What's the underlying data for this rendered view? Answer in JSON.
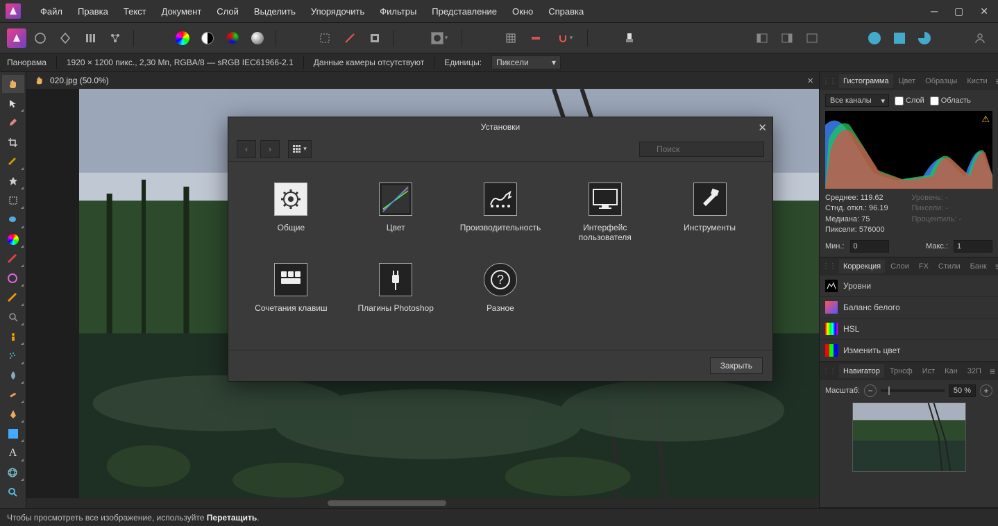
{
  "menu": [
    "Файл",
    "Правка",
    "Текст",
    "Документ",
    "Слой",
    "Выделить",
    "Упорядочить",
    "Фильтры",
    "Представление",
    "Окно",
    "Справка"
  ],
  "context": {
    "persona": "Панорама",
    "info": "1920 × 1200 пикс., 2,30 Мп, RGBA/8 — sRGB IEC61966-2.1",
    "camera": "Данные камеры отсутствуют",
    "units_label": "Единицы:",
    "units_value": "Пиксели"
  },
  "doc_tab": "020.jpg (50.0%)",
  "dialog": {
    "title": "Установки",
    "search_placeholder": "Поиск",
    "close_label": "Закрыть",
    "items": [
      {
        "label": "Общие"
      },
      {
        "label": "Цвет"
      },
      {
        "label": "Производительность"
      },
      {
        "label": "Интерфейс пользователя"
      },
      {
        "label": "Инструменты"
      },
      {
        "label": "Сочетания клавиш"
      },
      {
        "label": "Плагины Photoshop"
      },
      {
        "label": "Разное"
      }
    ]
  },
  "histogram": {
    "tabs": [
      "Гистограмма",
      "Цвет",
      "Образцы",
      "Кисти"
    ],
    "channel": "Все каналы",
    "layer_label": "Слой",
    "region_label": "Область",
    "stats": {
      "mean_label": "Среднее:",
      "mean": "119.62",
      "std_label": "Стнд. откл.:",
      "std": "96.19",
      "median_label": "Медиана:",
      "median": "75",
      "pixels_label": "Пиксели:",
      "pixels": "576000",
      "levels_label": "Уровень:",
      "levels": "-",
      "px2_label": "Пиксели:",
      "px2": "-",
      "pct_label": "Процентиль:",
      "pct": "-"
    },
    "min_label": "Мин.:",
    "min": "0",
    "max_label": "Макс.:",
    "max": "1"
  },
  "adjustments": {
    "tabs": [
      "Коррекция",
      "Слои",
      "FX",
      "Стили",
      "Банк"
    ],
    "items": [
      "Уровни",
      "Баланс белого",
      "HSL",
      "Изменить цвет"
    ]
  },
  "navigator": {
    "tabs": [
      "Навигатор",
      "Трнсф",
      "Ист",
      "Кан",
      "32П"
    ],
    "zoom_label": "Масштаб:",
    "zoom_value": "50 %"
  },
  "status": {
    "prefix": "Чтобы просмотреть все изображение, используйте ",
    "bold": "Перетащить",
    "suffix": "."
  },
  "tools_left": [
    "hand",
    "arrow",
    "eyedropper",
    "crop",
    "brush",
    "fx",
    "marquee",
    "bucket",
    "circle",
    "brush2",
    "heal",
    "brush3",
    "zoom-lens",
    "person",
    "spray",
    "drop",
    "bandage",
    "pen",
    "square",
    "text",
    "mesh",
    "zoom"
  ]
}
